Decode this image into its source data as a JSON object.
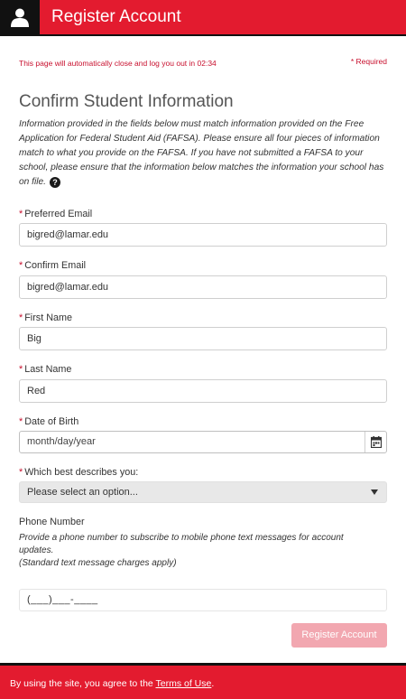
{
  "header": {
    "title": "Register Account"
  },
  "timer_text": "This page will automatically close and log you out in 02:34",
  "required_note": "* Required",
  "section_title": "Confirm Student Information",
  "description": "Information provided in the fields below must match information provided on the Free Application for Federal Student Aid (FAFSA). Please ensure all four pieces of information match to what you provide on the FAFSA. If you have not submitted a FAFSA to your school, please ensure that the information below matches the information your school has on file.",
  "required_marker": "*",
  "fields": {
    "preferred_email": {
      "label": "Preferred Email",
      "value": "bigred@lamar.edu"
    },
    "confirm_email": {
      "label": "Confirm Email",
      "value": "bigred@lamar.edu"
    },
    "first_name": {
      "label": "First Name",
      "value": "Big"
    },
    "last_name": {
      "label": "Last Name",
      "value": "Red"
    },
    "date_of_birth": {
      "label": "Date of Birth",
      "placeholder": "month/day/year"
    },
    "describes_you": {
      "label": "Which best describes you:",
      "value": "Please select an option..."
    }
  },
  "phone": {
    "label": "Phone Number",
    "description_line1": "Provide a phone number to subscribe to mobile phone text messages for account updates.",
    "description_line2": "(Standard text message charges apply)",
    "mask": "(___)___-____"
  },
  "submit_label": "Register Account",
  "footer": {
    "prefix": "By using the site, you agree to the ",
    "link": "Terms of Use",
    "suffix": "."
  },
  "icons": {
    "user": "user-icon",
    "help": "help-icon",
    "calendar": "calendar-icon",
    "dropdown": "chevron-down-icon"
  },
  "colors": {
    "brand_red": "#e31b2f",
    "header_dark": "#111111",
    "alert_red": "#c8102e",
    "disabled_button": "#f2a7b0"
  }
}
